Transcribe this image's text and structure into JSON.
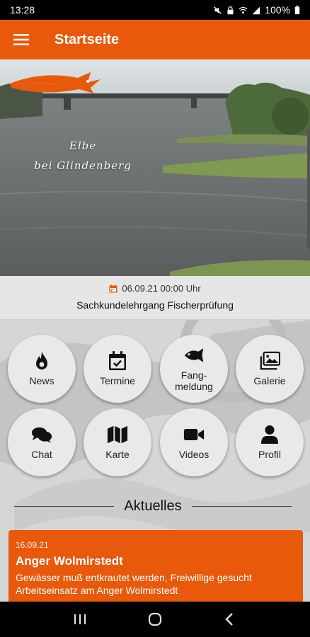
{
  "status_bar": {
    "time": "13:28",
    "battery": "100%"
  },
  "app_bar": {
    "title": "Startseite",
    "menu_icon": "hamburger-menu-icon"
  },
  "hero": {
    "line1": "Elbe",
    "line2": "bei Glindenberg"
  },
  "event": {
    "date": "06.09.21 00:00 Uhr",
    "title": "Sachkundelehrgang Fischerprüfung"
  },
  "tiles": [
    {
      "label": "News",
      "icon": "flame-icon"
    },
    {
      "label": "Termine",
      "icon": "calendar-check-icon"
    },
    {
      "label": "Fang-\nmeldung",
      "icon": "fish-icon"
    },
    {
      "label": "Galerie",
      "icon": "images-icon"
    },
    {
      "label": "Chat",
      "icon": "chat-icon"
    },
    {
      "label": "Karte",
      "icon": "map-icon"
    },
    {
      "label": "Videos",
      "icon": "video-camera-icon"
    },
    {
      "label": "Profil",
      "icon": "user-icon"
    }
  ],
  "section": {
    "title": "Aktuelles"
  },
  "news": {
    "date": "16.09.21",
    "title": "Anger Wolmirstedt",
    "text1": "Gewässer muß entkrautet werden, Freiwillige gesucht",
    "text2": "Arbeitseinsatz am Anger Wolmirstedt"
  },
  "colors": {
    "accent": "#e8590c",
    "tile": "#e9e9e9",
    "card": "#e6e6e6"
  }
}
